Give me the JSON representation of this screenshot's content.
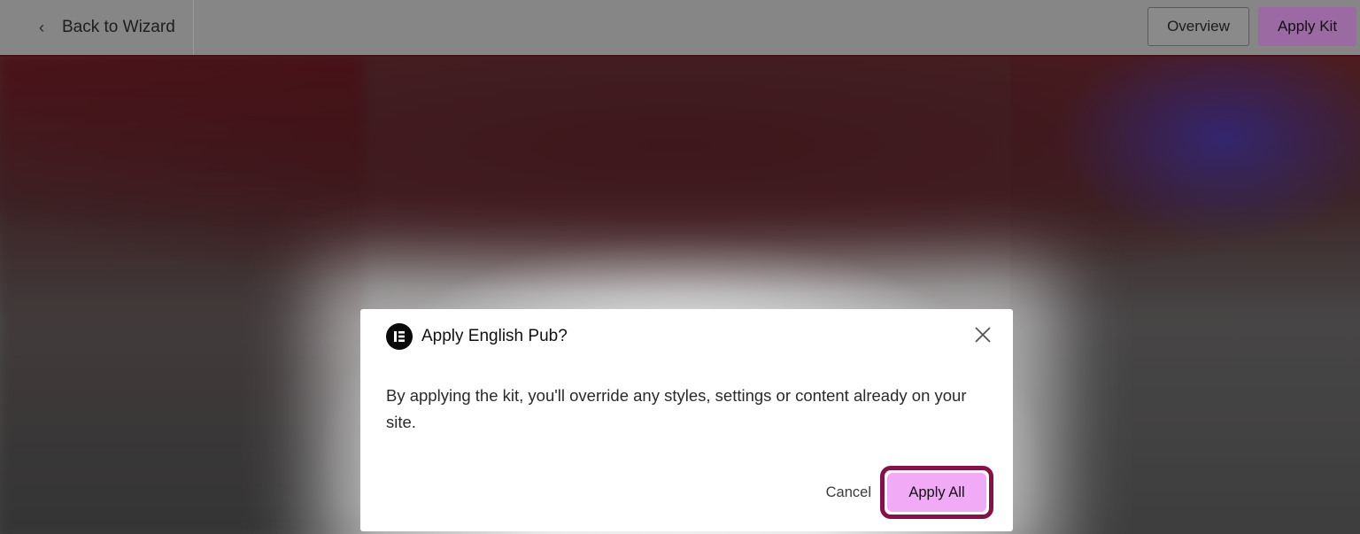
{
  "topbar": {
    "back_label": "Back to Wizard",
    "back_icon": "chevron-left-icon",
    "overview_label": "Overview",
    "apply_kit_label": "Apply Kit"
  },
  "dialog": {
    "logo_icon": "elementor-logo-icon",
    "title": "Apply English Pub?",
    "close_icon": "close-icon",
    "body": "By applying the kit, you'll override any styles, settings or content already on your site.",
    "cancel_label": "Cancel",
    "apply_all_label": "Apply All"
  },
  "colors": {
    "apply_button": "#f0aaf6",
    "highlight_ring": "#861048",
    "apply_kit_button": "#9c6aa2"
  }
}
